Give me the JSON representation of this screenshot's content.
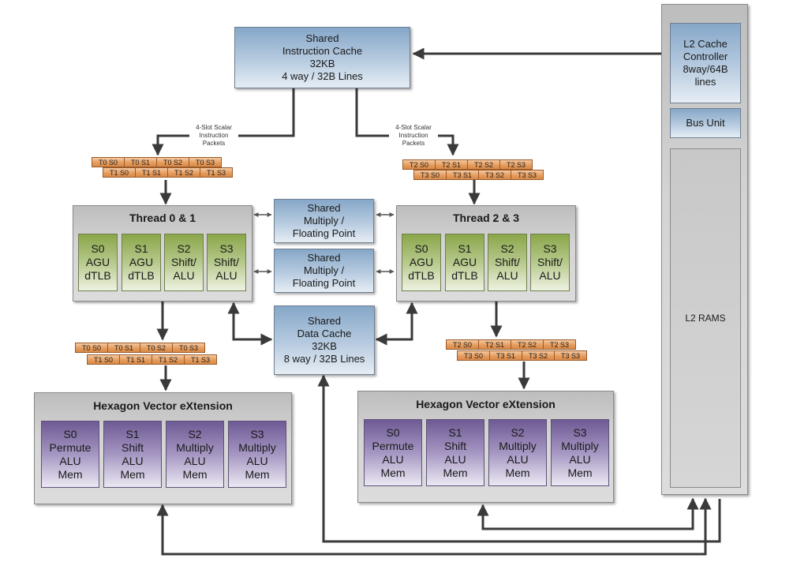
{
  "icache": {
    "lines": [
      "Shared",
      "Instruction Cache",
      "32KB",
      "4 way / 32B Lines"
    ]
  },
  "dcache": {
    "lines": [
      "Shared",
      "Data Cache",
      "32KB",
      "8 way / 32B Lines"
    ]
  },
  "mpy_fp": [
    {
      "lines": [
        "Shared",
        "Multiply /",
        "Floating Point"
      ]
    },
    {
      "lines": [
        "Shared",
        "Multiply /",
        "Floating Point"
      ]
    }
  ],
  "packet_label": {
    "lines": [
      "4-Slot Scalar",
      "Instruction",
      "Packets"
    ]
  },
  "packets": {
    "left_top": {
      "row1": [
        "T0 S0",
        "T0 S1",
        "T0 S2",
        "T0 S3"
      ],
      "row2": [
        "T1 S0",
        "T1 S1",
        "T1 S2",
        "T1 S3"
      ]
    },
    "right_top": {
      "row1": [
        "T2 S0",
        "T2 S1",
        "T2 S2",
        "T2 S3"
      ],
      "row2": [
        "T3 S0",
        "T3 S1",
        "T3 S2",
        "T3 S3"
      ]
    },
    "left_bottom": {
      "row1": [
        "T0 S0",
        "T0 S1",
        "T0 S2",
        "T0 S3"
      ],
      "row2": [
        "T1 S0",
        "T1 S1",
        "T1 S2",
        "T1 S3"
      ]
    },
    "right_bottom": {
      "row1": [
        "T2 S0",
        "T2 S1",
        "T2 S2",
        "T2 S3"
      ],
      "row2": [
        "T3 S0",
        "T3 S1",
        "T3 S2",
        "T3 S3"
      ]
    }
  },
  "thread_left": {
    "title": "Thread 0 & 1",
    "slots": [
      {
        "lines": [
          "S0",
          "AGU",
          "dTLB"
        ]
      },
      {
        "lines": [
          "S1",
          "AGU",
          "dTLB"
        ]
      },
      {
        "lines": [
          "S2",
          "Shift/",
          "ALU"
        ]
      },
      {
        "lines": [
          "S3",
          "Shift/",
          "ALU"
        ]
      }
    ]
  },
  "thread_right": {
    "title": "Thread 2 & 3",
    "slots": [
      {
        "lines": [
          "S0",
          "AGU",
          "dTLB"
        ]
      },
      {
        "lines": [
          "S1",
          "AGU",
          "dTLB"
        ]
      },
      {
        "lines": [
          "S2",
          "Shift/",
          "ALU"
        ]
      },
      {
        "lines": [
          "S3",
          "Shift/",
          "ALU"
        ]
      }
    ]
  },
  "hvx_left": {
    "title": "Hexagon Vector eXtension",
    "slots": [
      {
        "lines": [
          "S0",
          "Permute",
          "ALU",
          "Mem"
        ]
      },
      {
        "lines": [
          "S1",
          "Shift",
          "ALU",
          "Mem"
        ]
      },
      {
        "lines": [
          "S2",
          "Multiply",
          "ALU",
          "Mem"
        ]
      },
      {
        "lines": [
          "S3",
          "Multiply",
          "ALU",
          "Mem"
        ]
      }
    ]
  },
  "hvx_right": {
    "title": "Hexagon Vector eXtension",
    "slots": [
      {
        "lines": [
          "S0",
          "Permute",
          "ALU",
          "Mem"
        ]
      },
      {
        "lines": [
          "S1",
          "Shift",
          "ALU",
          "Mem"
        ]
      },
      {
        "lines": [
          "S2",
          "Multiply",
          "ALU",
          "Mem"
        ]
      },
      {
        "lines": [
          "S3",
          "Multiply",
          "ALU",
          "Mem"
        ]
      }
    ]
  },
  "l2": {
    "controller": {
      "lines": [
        "L2 Cache",
        "Controller",
        "8way/64B",
        "lines"
      ]
    },
    "bus_unit": "Bus Unit",
    "rams": "L2 RAMS"
  },
  "colors": {
    "cache_blue": "#86a7c8",
    "scalar_green": "#8aa64a",
    "vector_purple": "#6e5a94",
    "packet_orange": "#e59a5a",
    "wire": "#3a3a3a"
  }
}
